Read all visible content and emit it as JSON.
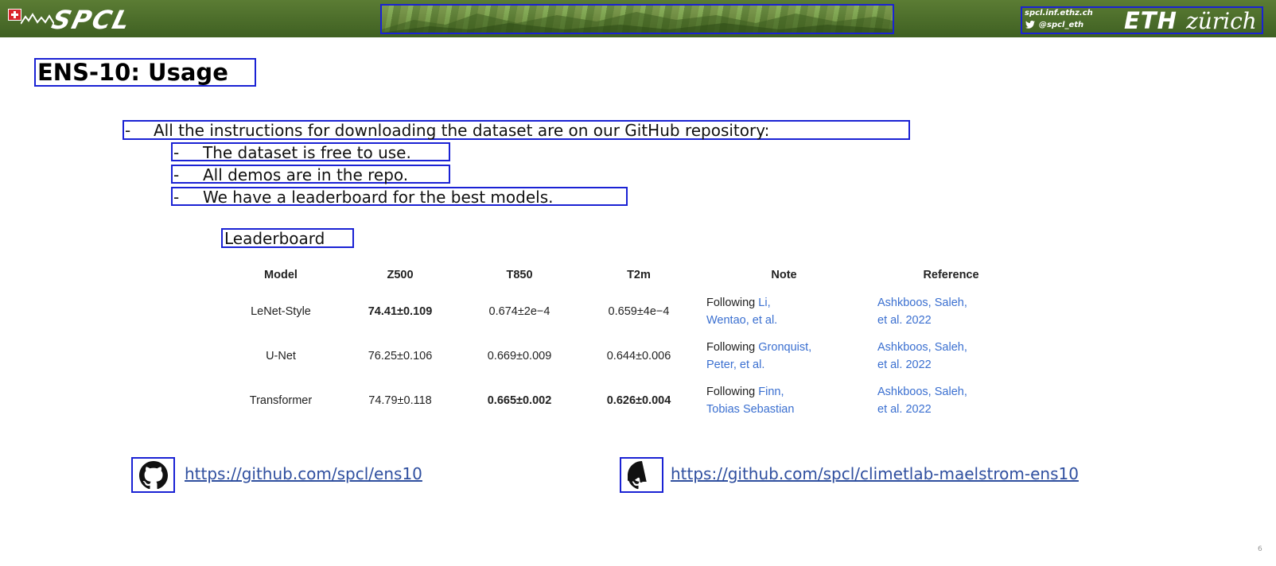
{
  "header": {
    "logo_text": "SPCL",
    "site": "spcl.inf.ethz.ch",
    "twitter": "@spcl_eth",
    "eth": "ETH",
    "zurich": "zürich"
  },
  "title": "ENS-10: Usage",
  "bullets": [
    {
      "dash": "-",
      "text": "All the instructions for downloading the dataset are on our GitHub repository:"
    },
    {
      "dash": "-",
      "text": "The dataset is free to use."
    },
    {
      "dash": "-",
      "text": "All demos are in the repo."
    },
    {
      "dash": "-",
      "text": "We have a leaderboard for the best models."
    }
  ],
  "leaderboard_label": "Leaderboard",
  "table": {
    "headers": [
      "Model",
      "Z500",
      "T850",
      "T2m",
      "Note",
      "Reference"
    ],
    "rows": [
      {
        "model": "LeNet-Style",
        "z500": "74.41±0.109",
        "t850": "0.674±2e−4",
        "t2m": "0.659±4e−4",
        "note_prefix": "Following ",
        "note_link": "Li,",
        "note_line2": "Wentao, et al.",
        "ref_line1": "Ashkboos, Saleh,",
        "ref_line2": "et al. 2022"
      },
      {
        "model": "U-Net",
        "z500": "76.25±0.106",
        "t850": "0.669±0.009",
        "t2m": "0.644±0.006",
        "note_prefix": "Following ",
        "note_link": "Gronquist,",
        "note_line2": "Peter, et al.",
        "ref_line1": "Ashkboos, Saleh,",
        "ref_line2": "et al. 2022"
      },
      {
        "model": "Transformer",
        "z500": "74.79±0.118",
        "t850": "0.665±0.002",
        "t2m": "0.626±0.004",
        "note_prefix": "Following ",
        "note_link": "Finn,",
        "note_line2": "Tobias Sebastian",
        "ref_line1": "Ashkboos, Saleh,",
        "ref_line2": "et al. 2022"
      }
    ]
  },
  "links": [
    {
      "icon": "github-icon",
      "url": "https://github.com/spcl/ens10"
    },
    {
      "icon": "github-icon",
      "url": "https://github.com/spcl/climetlab-maelstrom-ens10"
    }
  ],
  "page_number": "6",
  "colors": {
    "header_green": "#4a6b2a",
    "annotation_blue": "#1a22d4",
    "link_blue": "#3a6fd0"
  }
}
